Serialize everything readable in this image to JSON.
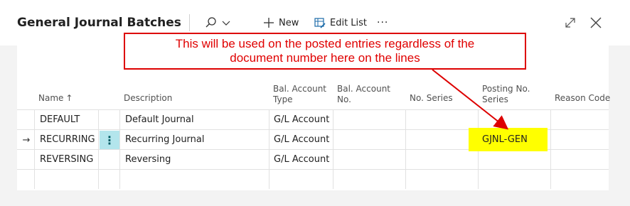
{
  "dialog": {
    "title": "General Journal Batches"
  },
  "toolbar": {
    "new_label": "New",
    "edit_list_label": "Edit List",
    "more_label": "···"
  },
  "annotation": {
    "line1": "This will be used on the posted entries regardless of the",
    "line2": "document number here on the lines",
    "border_color": "#dd0000",
    "text_color": "#e00000",
    "highlight_color": "#ffff00"
  },
  "table": {
    "columns": {
      "name": "Name",
      "name_sort": "↑",
      "description": "Description",
      "bal_account_type_1": "Bal. Account",
      "bal_account_type_2": "Type",
      "bal_account_no_1": "Bal. Account",
      "bal_account_no_2": "No.",
      "no_series": "No. Series",
      "posting_no_series_1": "Posting No.",
      "posting_no_series_2": "Series",
      "reason_code": "Reason Code"
    },
    "rows": [
      {
        "name": "DEFAULT",
        "description": "Default Journal",
        "bal_account_type": "G/L Account",
        "bal_account_no": "",
        "no_series": "",
        "posting_no_series": "",
        "reason_code": ""
      },
      {
        "name": "RECURRING",
        "description": "Recurring Journal",
        "bal_account_type": "G/L Account",
        "bal_account_no": "",
        "no_series": "",
        "posting_no_series": "GJNL-GEN",
        "reason_code": "",
        "selected": true,
        "row_marker": "→",
        "actions": "⋮"
      },
      {
        "name": "REVERSING",
        "description": "Reversing",
        "bal_account_type": "G/L Account",
        "bal_account_no": "",
        "no_series": "",
        "posting_no_series": "",
        "reason_code": ""
      }
    ],
    "accent_color": "#b3e5ec"
  }
}
